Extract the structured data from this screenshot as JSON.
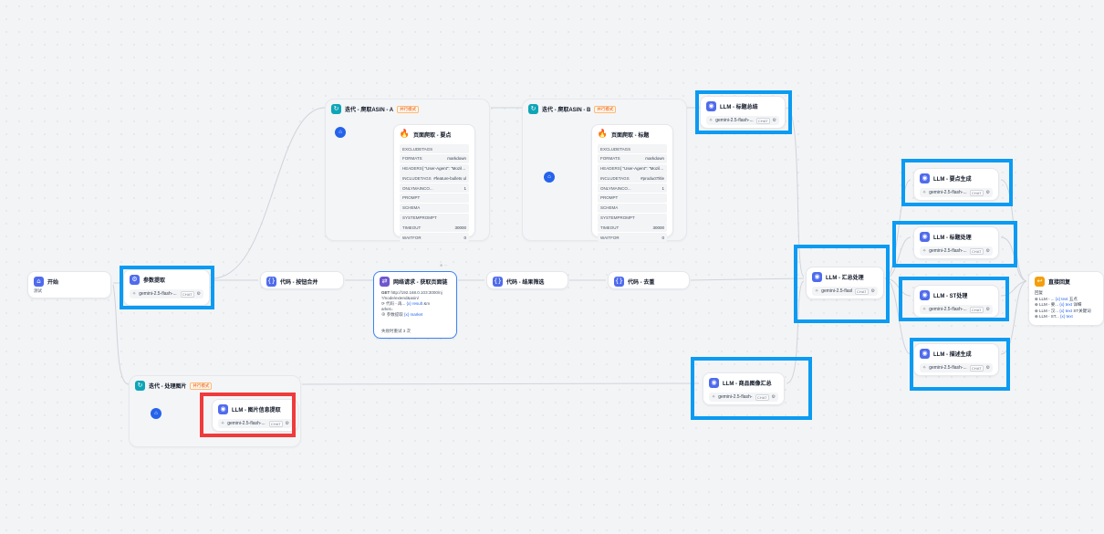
{
  "nodes": {
    "start": {
      "title": "开始",
      "subtitle": "测试"
    },
    "param": {
      "title": "参数提取",
      "model": "gemini-2.5-flash-...",
      "mode": "CHAT"
    },
    "code_merge": {
      "title": "代码 - 按钮合并"
    },
    "http": {
      "title": "网络请求 - 获取页面链",
      "method": "GET",
      "url": "http://192.168.0.103:3000/nj",
      "url2": "?/node/extend&asin/",
      "line1_a": "⟳ 代码 - 再...",
      "line1_var": "{x} result",
      "line1_b": "&m",
      "line2": "arket=",
      "line3_a": "⊕ 参数提取",
      "line3_var": "{x} market",
      "footer": "失败时重试 3 次",
      "ctrl": "⊕ ⋯"
    },
    "code_filter": {
      "title": "代码 - 结果筛选"
    },
    "code_dedupe": {
      "title": "代码 - 去重"
    },
    "iter_a": {
      "title": "迭代 - 爬取ASIN - A",
      "badge": "并行模式",
      "scrape_title": "页面爬取 - 要点",
      "fields": [
        {
          "k": "EXCLUDETAGS",
          "v": ""
        },
        {
          "k": "FORMATS",
          "v": "markdown"
        },
        {
          "k": "HEADERS",
          "v": "{ \"User-Agent\": \"Mozilla..."
        },
        {
          "k": "INCLUDETAGS",
          "v": "#feature-bullets ul"
        },
        {
          "k": "ONLYMAINCO...",
          "v": "1"
        },
        {
          "k": "PROMPT",
          "v": ""
        },
        {
          "k": "SCHEMA",
          "v": ""
        },
        {
          "k": "SYSTEMPROMPT",
          "v": ""
        },
        {
          "k": "TIMEOUT",
          "v": "30000"
        },
        {
          "k": "WAITFOR",
          "v": "0"
        }
      ]
    },
    "iter_b": {
      "title": "迭代 - 爬取ASIN - B",
      "badge": "并行模式",
      "scrape_title": "页面爬取 - 标题",
      "fields": [
        {
          "k": "EXCLUDETAGS",
          "v": ""
        },
        {
          "k": "FORMATS",
          "v": "markdown"
        },
        {
          "k": "HEADERS",
          "v": "{ \"User-Agent\": \"Mozilla..."
        },
        {
          "k": "INCLUDETAGS",
          "v": "#productTitle"
        },
        {
          "k": "ONLYMAINCO...",
          "v": "1"
        },
        {
          "k": "PROMPT",
          "v": ""
        },
        {
          "k": "SCHEMA",
          "v": ""
        },
        {
          "k": "SYSTEMPROMPT",
          "v": ""
        },
        {
          "k": "TIMEOUT",
          "v": "30000"
        },
        {
          "k": "WAITFOR",
          "v": "0"
        }
      ]
    },
    "llm_title_summary": {
      "title": "LLM - 标题总结",
      "model": "gemini-2.5-flash-...",
      "mode": "CHAT"
    },
    "llm_aggregate": {
      "title": "LLM - 汇总处理",
      "model": "gemini-2.5-flash-...",
      "mode": "CHAT"
    },
    "llm_points": {
      "title": "LLM - 要点生成",
      "model": "gemini-2.5-flash-...",
      "mode": "CHAT"
    },
    "llm_title_proc": {
      "title": "LLM - 标题处理",
      "model": "gemini-2.5-flash-...",
      "mode": "CHAT"
    },
    "llm_st": {
      "title": "LLM - ST处理",
      "model": "gemini-2.5-flash-...",
      "mode": "CHAT"
    },
    "llm_desc": {
      "title": "LLM - 描述生成",
      "model": "gemini-2.5-flash-...",
      "mode": "CHAT"
    },
    "llm_img_summary": {
      "title": "LLM - 商品图像汇总",
      "model": "gemini-2.5-flash-...",
      "mode": "CHAT"
    },
    "iter_img": {
      "title": "迭代 - 处理图片",
      "badge": "并行模式",
      "llm_title": "LLM - 图片信息提取",
      "llm_model": "gemini-2.5-flash-...",
      "llm_mode": "CHAT"
    },
    "end": {
      "title": "直接回复",
      "label": "回复",
      "row1_a": "⊕ LLM - ...",
      "row1_b": "{x} text",
      "row1_c": "五点",
      "row2_a": "⊕ LLM - 要...",
      "row2_b": "{x} text",
      "row2_c": "详细",
      "row3_a": "⊕ LLM - 汉...",
      "row3_b": "{x} text",
      "row3_c": "ST关键词",
      "row4_a": "⊕ LLM - ST...",
      "row4_b": "{x} text",
      "row4_c": ""
    }
  },
  "icons": {
    "llm": "llm-brain-icon",
    "code": "code-icon",
    "iteration": "iteration-loop-icon",
    "http": "http-request-icon",
    "scrape": "flame-scrape-icon",
    "start": "home-start-icon",
    "end": "reply-icon",
    "gear": "gear-icon",
    "model": "model-spark-icon"
  },
  "colors": {
    "highlight_blue": "#0a9bf2",
    "highlight_red": "#ef3b3b",
    "node_blue": "#4f6bed",
    "node_cyan": "#0ea5b7",
    "node_orange": "#f59e0b",
    "accent": "#2563eb"
  }
}
